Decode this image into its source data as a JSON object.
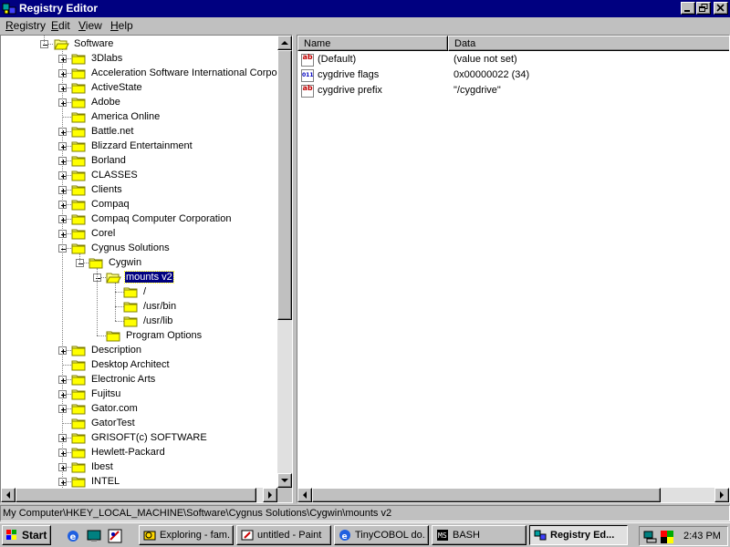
{
  "window": {
    "title": "Registry Editor",
    "title_bar_color": "#000080"
  },
  "menu": [
    {
      "label": "Registry",
      "accel": "R",
      "rest": "egistry"
    },
    {
      "label": "Edit",
      "accel": "E",
      "rest": "dit"
    },
    {
      "label": "View",
      "accel": "V",
      "rest": "iew"
    },
    {
      "label": "Help",
      "accel": "H",
      "rest": "elp"
    }
  ],
  "tree": {
    "items": [
      {
        "label": "Software",
        "level": 0,
        "expander": "minus",
        "icon": "folder-open-icon"
      },
      {
        "label": "3Dlabs",
        "level": 1,
        "expander": "plus",
        "icon": "folder-icon"
      },
      {
        "label": "Acceleration Software International Corporation",
        "level": 1,
        "expander": "plus",
        "icon": "folder-icon"
      },
      {
        "label": "ActiveState",
        "level": 1,
        "expander": "plus",
        "icon": "folder-icon"
      },
      {
        "label": "Adobe",
        "level": 1,
        "expander": "plus",
        "icon": "folder-icon"
      },
      {
        "label": "America Online",
        "level": 1,
        "expander": "none",
        "icon": "folder-icon"
      },
      {
        "label": "Battle.net",
        "level": 1,
        "expander": "plus",
        "icon": "folder-icon"
      },
      {
        "label": "Blizzard Entertainment",
        "level": 1,
        "expander": "plus",
        "icon": "folder-icon"
      },
      {
        "label": "Borland",
        "level": 1,
        "expander": "plus",
        "icon": "folder-icon"
      },
      {
        "label": "CLASSES",
        "level": 1,
        "expander": "plus",
        "icon": "folder-icon"
      },
      {
        "label": "Clients",
        "level": 1,
        "expander": "plus",
        "icon": "folder-icon"
      },
      {
        "label": "Compaq",
        "level": 1,
        "expander": "plus",
        "icon": "folder-icon"
      },
      {
        "label": "Compaq Computer Corporation",
        "level": 1,
        "expander": "plus",
        "icon": "folder-icon"
      },
      {
        "label": "Corel",
        "level": 1,
        "expander": "plus",
        "icon": "folder-icon"
      },
      {
        "label": "Cygnus Solutions",
        "level": 1,
        "expander": "minus",
        "icon": "folder-icon"
      },
      {
        "label": "Cygwin",
        "level": 2,
        "expander": "minus",
        "icon": "folder-icon"
      },
      {
        "label": "mounts v2",
        "level": 3,
        "expander": "minus",
        "icon": "folder-open-icon",
        "selected": true
      },
      {
        "label": "/",
        "level": 4,
        "expander": "none",
        "icon": "folder-icon"
      },
      {
        "label": "/usr/bin",
        "level": 4,
        "expander": "none",
        "icon": "folder-icon"
      },
      {
        "label": "/usr/lib",
        "level": 4,
        "expander": "none",
        "icon": "folder-icon"
      },
      {
        "label": "Program Options",
        "level": 3,
        "expander": "none",
        "icon": "folder-icon"
      },
      {
        "label": "Description",
        "level": 1,
        "expander": "plus",
        "icon": "folder-icon"
      },
      {
        "label": "Desktop Architect",
        "level": 1,
        "expander": "none",
        "icon": "folder-icon"
      },
      {
        "label": "Electronic Arts",
        "level": 1,
        "expander": "plus",
        "icon": "folder-icon"
      },
      {
        "label": "Fujitsu",
        "level": 1,
        "expander": "plus",
        "icon": "folder-icon"
      },
      {
        "label": "Gator.com",
        "level": 1,
        "expander": "plus",
        "icon": "folder-icon"
      },
      {
        "label": "GatorTest",
        "level": 1,
        "expander": "none",
        "icon": "folder-icon"
      },
      {
        "label": "GRISOFT(c) SOFTWARE",
        "level": 1,
        "expander": "plus",
        "icon": "folder-icon"
      },
      {
        "label": "Hewlett-Packard",
        "level": 1,
        "expander": "plus",
        "icon": "folder-icon"
      },
      {
        "label": "Ibest",
        "level": 1,
        "expander": "plus",
        "icon": "folder-icon"
      },
      {
        "label": "INTEL",
        "level": 1,
        "expander": "plus",
        "icon": "folder-icon"
      }
    ]
  },
  "values_list": {
    "headers": {
      "name": "Name",
      "data": "Data"
    },
    "rows": [
      {
        "name": "(Default)",
        "data": "(value not set)",
        "icon": "string-value-icon",
        "icon_text": "ab"
      },
      {
        "name": "cygdrive flags",
        "data": "0x00000022 (34)",
        "icon": "binary-value-icon",
        "icon_text": "011"
      },
      {
        "name": "cygdrive prefix",
        "data": "\"/cygdrive\"",
        "icon": "string-value-icon",
        "icon_text": "ab"
      }
    ]
  },
  "status": {
    "path": "My Computer\\HKEY_LOCAL_MACHINE\\Software\\Cygnus Solutions\\Cygwin\\mounts v2"
  },
  "taskbar": {
    "start_label": "Start",
    "quick_launch": [
      "internet-explorer-icon",
      "desktop-icon",
      "channels-icon"
    ],
    "tasks": [
      {
        "label": "Exploring - fam...",
        "icon": "explorer-icon",
        "active": false
      },
      {
        "label": "untitled - Paint",
        "icon": "paint-icon",
        "active": false
      },
      {
        "label": "TinyCOBOL do...",
        "icon": "ie-document-icon",
        "active": false
      },
      {
        "label": "BASH",
        "icon": "bash-icon",
        "active": false
      },
      {
        "label": "Registry Ed...",
        "icon": "registry-icon",
        "active": true
      }
    ],
    "clock": "2:43 PM"
  }
}
